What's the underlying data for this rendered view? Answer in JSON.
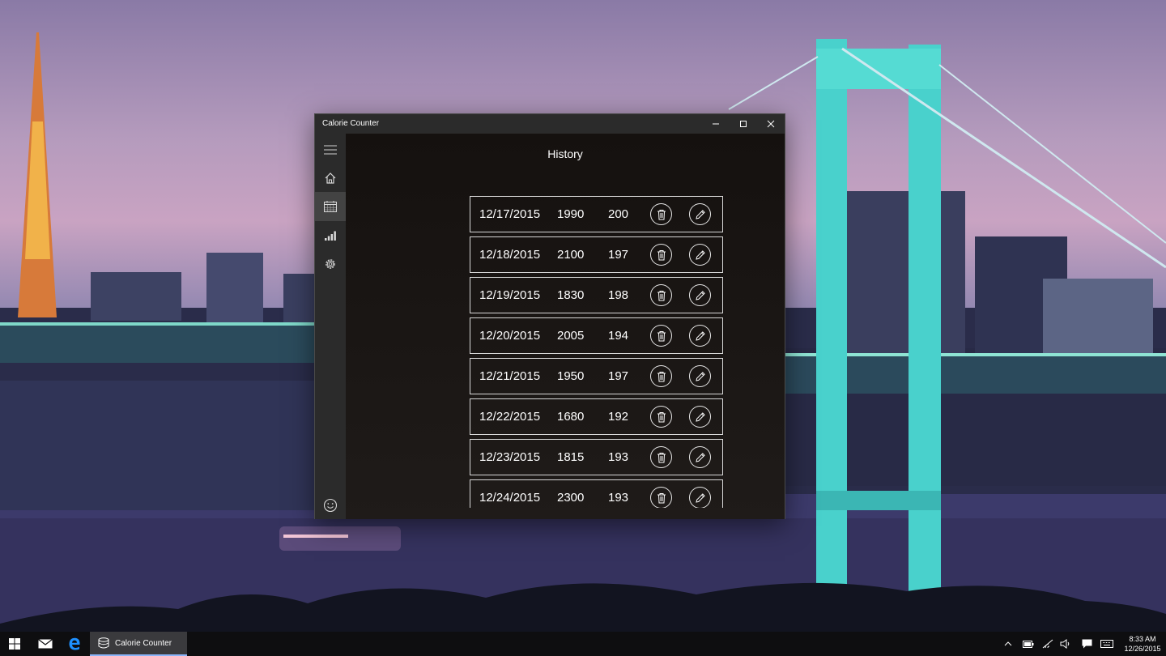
{
  "window": {
    "title": "Calorie Counter",
    "controls": {
      "minimize": "minimize",
      "maximize": "maximize",
      "close": "close"
    }
  },
  "sidebar": {
    "items": [
      {
        "icon": "hamburger-menu-icon",
        "active": false
      },
      {
        "icon": "home-icon",
        "active": false
      },
      {
        "icon": "calendar-icon",
        "active": true
      },
      {
        "icon": "bar-chart-icon",
        "active": false
      },
      {
        "icon": "gear-icon",
        "active": false
      }
    ],
    "bottom_icon": "smiley-icon"
  },
  "page": {
    "title": "History",
    "entries": [
      {
        "date": "12/17/2015",
        "calories": "1990",
        "weight": "200"
      },
      {
        "date": "12/18/2015",
        "calories": "2100",
        "weight": "197"
      },
      {
        "date": "12/19/2015",
        "calories": "1830",
        "weight": "198"
      },
      {
        "date": "12/20/2015",
        "calories": "2005",
        "weight": "194"
      },
      {
        "date": "12/21/2015",
        "calories": "1950",
        "weight": "197"
      },
      {
        "date": "12/22/2015",
        "calories": "1680",
        "weight": "192"
      },
      {
        "date": "12/23/2015",
        "calories": "1815",
        "weight": "193"
      },
      {
        "date": "12/24/2015",
        "calories": "2300",
        "weight": "193"
      }
    ]
  },
  "taskbar": {
    "app_label": "Calorie Counter",
    "time": "8:33 AM",
    "date": "12/26/2015"
  },
  "colors": {
    "window_bg": "#1a1715",
    "chrome": "#2b2b2b",
    "active_nav": "#434343",
    "row_border": "#d8d8d8",
    "taskbar": "#0e0e10"
  }
}
